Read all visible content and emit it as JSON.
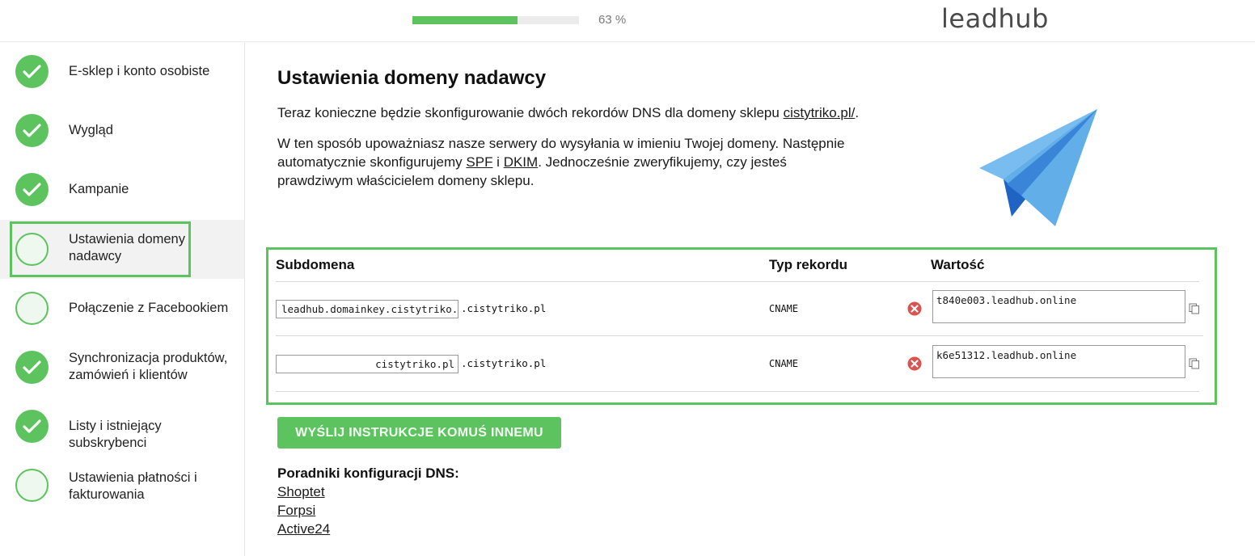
{
  "header": {
    "progress_percent": 63,
    "progress_text": "63 %",
    "logo_text": "leadhub"
  },
  "sidebar": {
    "items": [
      {
        "label": "E-sklep i konto osobiste",
        "status": "done"
      },
      {
        "label": "Wygląd",
        "status": "done"
      },
      {
        "label": "Kampanie",
        "status": "done"
      },
      {
        "label": "Ustawienia domeny nadawcy",
        "status": "current"
      },
      {
        "label": "Połączenie z Facebookiem",
        "status": "todo"
      },
      {
        "label": "Synchronizacja produktów, zamówień i klientów",
        "status": "done"
      },
      {
        "label": "Listy i istniejący subskrybenci",
        "status": "done"
      },
      {
        "label": "Ustawienia płatności i fakturowania",
        "status": "todo"
      }
    ]
  },
  "main": {
    "title": "Ustawienia domeny nadawcy",
    "intro_prefix": "Teraz konieczne będzie skonfigurowanie dwóch rekordów DNS dla domeny sklepu ",
    "intro_link": "cistytriko.pl/",
    "intro_suffix": ".",
    "explain_1": "W ten sposób upoważniasz nasze serwery do wysyłania w imieniu Twojej domeny. Następnie automatycznie skonfigurujemy ",
    "spf_link": "SPF",
    "explain_and": " i ",
    "dkim_link": "DKIM",
    "explain_2": ". Jednocześnie zweryfikujemy, czy jesteś prawdziwym właścicielem domeny sklepu."
  },
  "dns_table": {
    "headers": {
      "subdomain": "Subdomena",
      "type": "Typ rekordu",
      "value": "Wartość"
    },
    "rows": [
      {
        "subdomain": "leadhub.domainkey.cistytriko.pl",
        "suffix": ".cistytriko.pl",
        "type": "CNAME",
        "value": "t840e003.leadhub.online"
      },
      {
        "subdomain": "cistytriko.pl",
        "suffix": ".cistytriko.pl",
        "type": "CNAME",
        "value": "k6e51312.leadhub.online"
      }
    ]
  },
  "send_button_label": "WYŚLIJ INSTRUKCJE KOMUŚ INNEMU",
  "guides": {
    "title": "Poradniki konfiguracji DNS:",
    "links": [
      "Shoptet",
      "Forpsi",
      "Active24"
    ]
  },
  "colors": {
    "accent_green": "#5cc35e",
    "error_red": "#d9534f",
    "plane_light": "#6fb3ea",
    "plane_dark": "#1f63c4"
  },
  "icons": {
    "check": "check-icon",
    "error": "error-x-icon",
    "copy": "copy-icon",
    "plane": "paper-plane-icon"
  }
}
